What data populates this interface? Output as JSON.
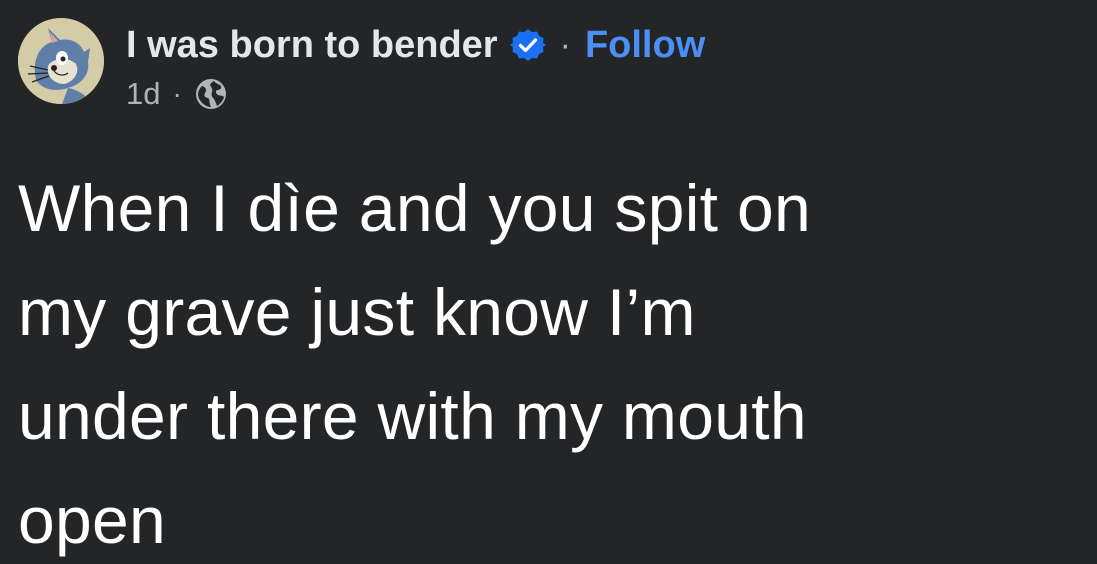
{
  "post": {
    "author": {
      "name": "I was born to bender",
      "avatar_icon": "cartoon-cat-avatar",
      "verified_icon": "verified-badge-icon",
      "verified_color": "#1d6ff2"
    },
    "separator": "·",
    "follow_label": "Follow",
    "follow_color": "#4b8ff7",
    "timestamp": "1d",
    "audience_icon": "globe-icon",
    "body_lines": [
      "When I dìe and you spit on",
      "my grave just know I’m",
      "under there with my mouth",
      "open"
    ]
  },
  "theme": {
    "background": "#242526",
    "text_primary": "#e4e6eb",
    "text_secondary": "#b0b3b8"
  }
}
